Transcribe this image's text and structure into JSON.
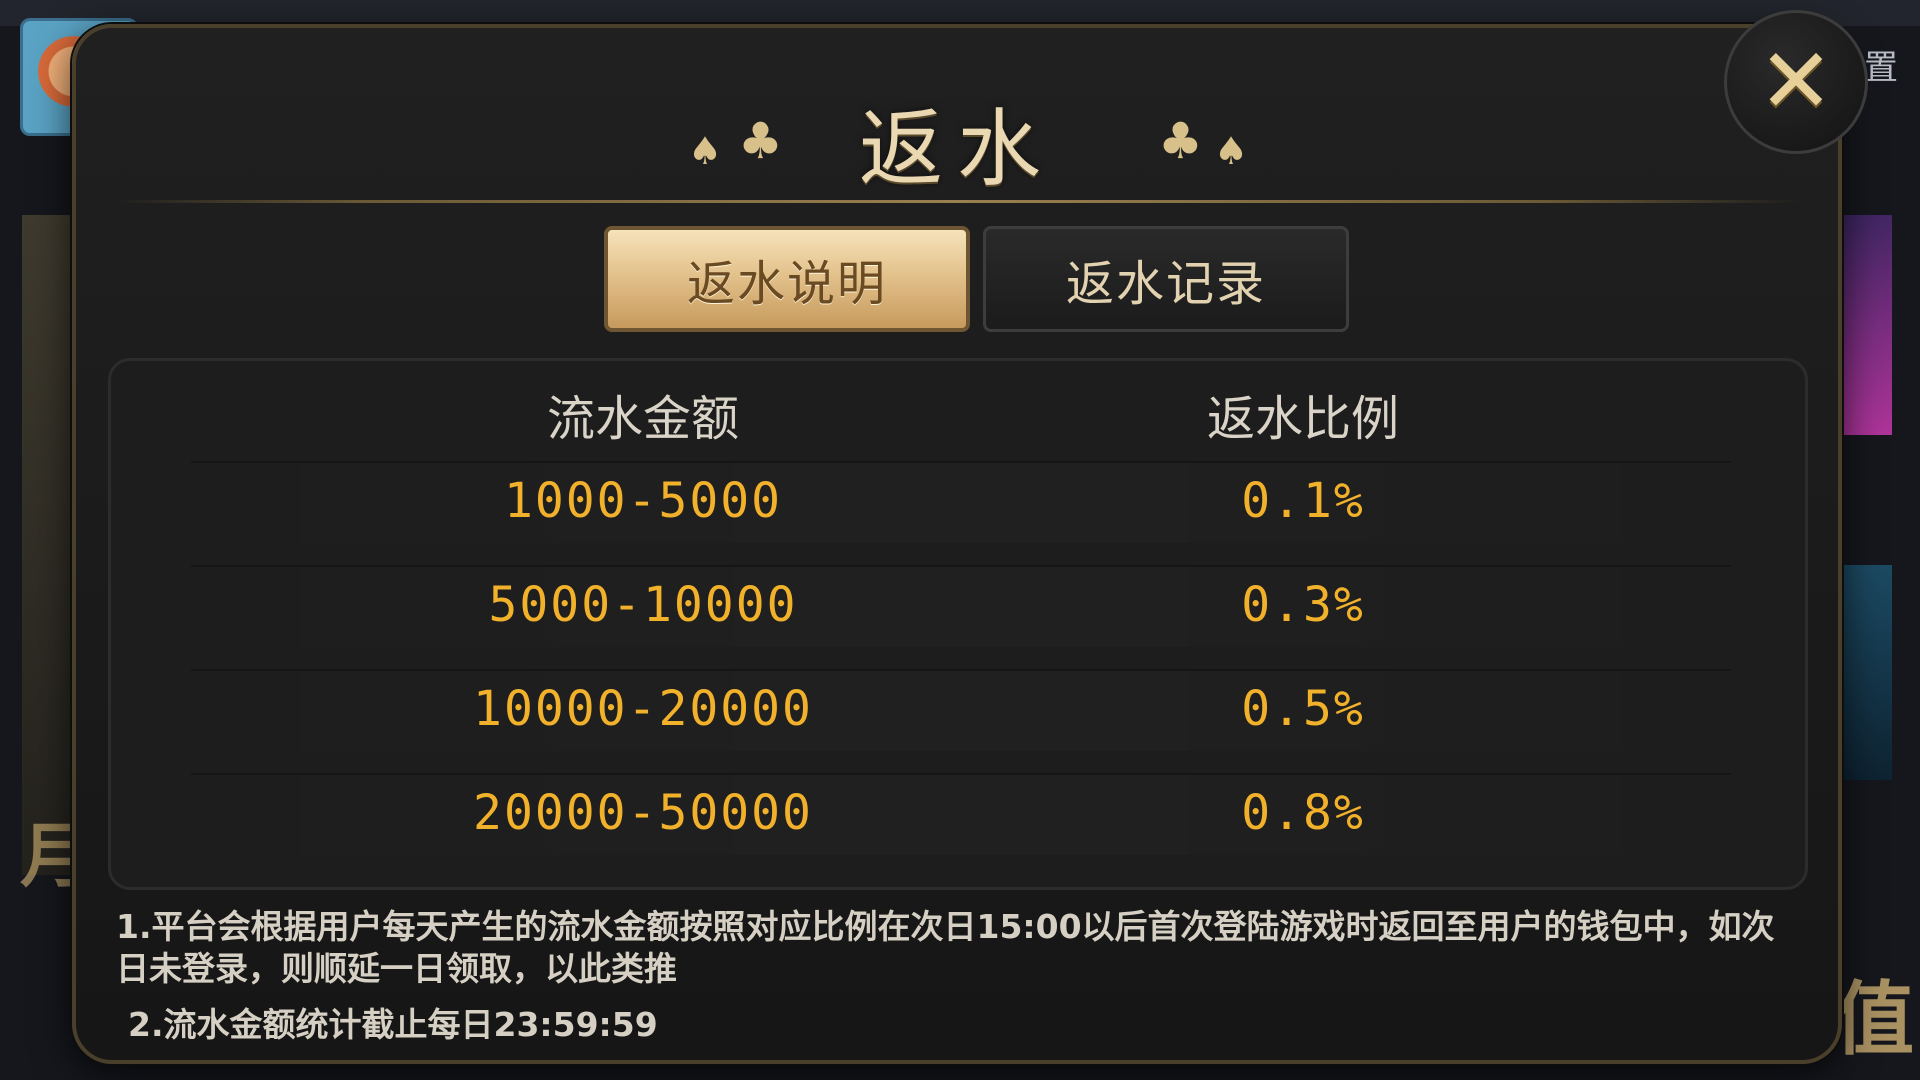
{
  "background": {
    "settings_text": "置",
    "left_text": "月",
    "right_text": "值"
  },
  "dialog": {
    "title": "返水",
    "close_symbol": "✕",
    "suits": [
      "♠",
      "♣",
      "♣",
      "♠"
    ]
  },
  "tabs": [
    {
      "label": "返水说明",
      "active": true
    },
    {
      "label": "返水记录",
      "active": false
    }
  ],
  "table": {
    "headers": [
      "流水金额",
      "返水比例"
    ],
    "rows": [
      {
        "amount": "1000-5000",
        "ratio": "0.1%"
      },
      {
        "amount": "5000-10000",
        "ratio": "0.3%"
      },
      {
        "amount": "10000-20000",
        "ratio": "0.5%"
      },
      {
        "amount": "20000-50000",
        "ratio": "0.8%"
      }
    ]
  },
  "notes": [
    "1.平台会根据用户每天产生的流水金额按照对应比例在次日15:00以后首次登陆游戏时返回至用户的钱包中，如次日未登录，则顺延一日领取，以此类推",
    "2.流水金额统计截止每日23:59:59"
  ],
  "colors": {
    "accent_gold": "#f2b12b",
    "title_gold": "#e9d8b2",
    "tab_active_bg": "#e3c28c"
  }
}
